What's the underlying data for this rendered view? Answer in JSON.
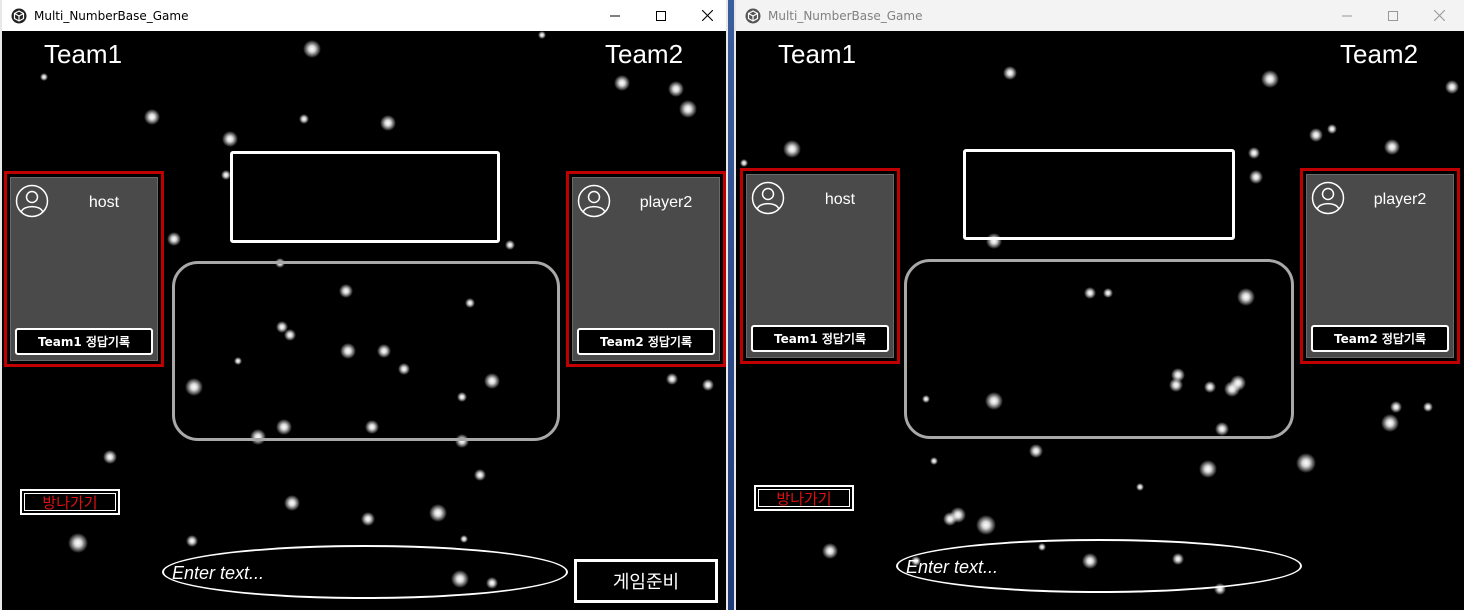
{
  "windows": [
    {
      "title": "Multi_NumberBase_Game",
      "team1_label": "Team1",
      "team2_label": "Team2",
      "team1_player": "host",
      "team2_player": "player2",
      "team1_record": "Team1 정답기록",
      "team2_record": "Team2 정답기록",
      "leave_label": "방나가기",
      "chat_placeholder": "Enter text...",
      "ready_label": "게임준비"
    },
    {
      "title": "Multi_NumberBase_Game",
      "team1_label": "Team1",
      "team2_label": "Team2",
      "team1_player": "host",
      "team2_player": "player2",
      "team1_record": "Team1 정답기록",
      "team2_record": "Team2 정답기록",
      "leave_label": "방나가기",
      "chat_placeholder": "Enter text..."
    }
  ],
  "colors": {
    "card_border": "#c00000",
    "leave_text": "#e01010",
    "background": "#000000"
  },
  "icons": [
    "unity-app-icon",
    "minimize-icon",
    "maximize-icon",
    "close-icon",
    "user-avatar-icon"
  ]
}
